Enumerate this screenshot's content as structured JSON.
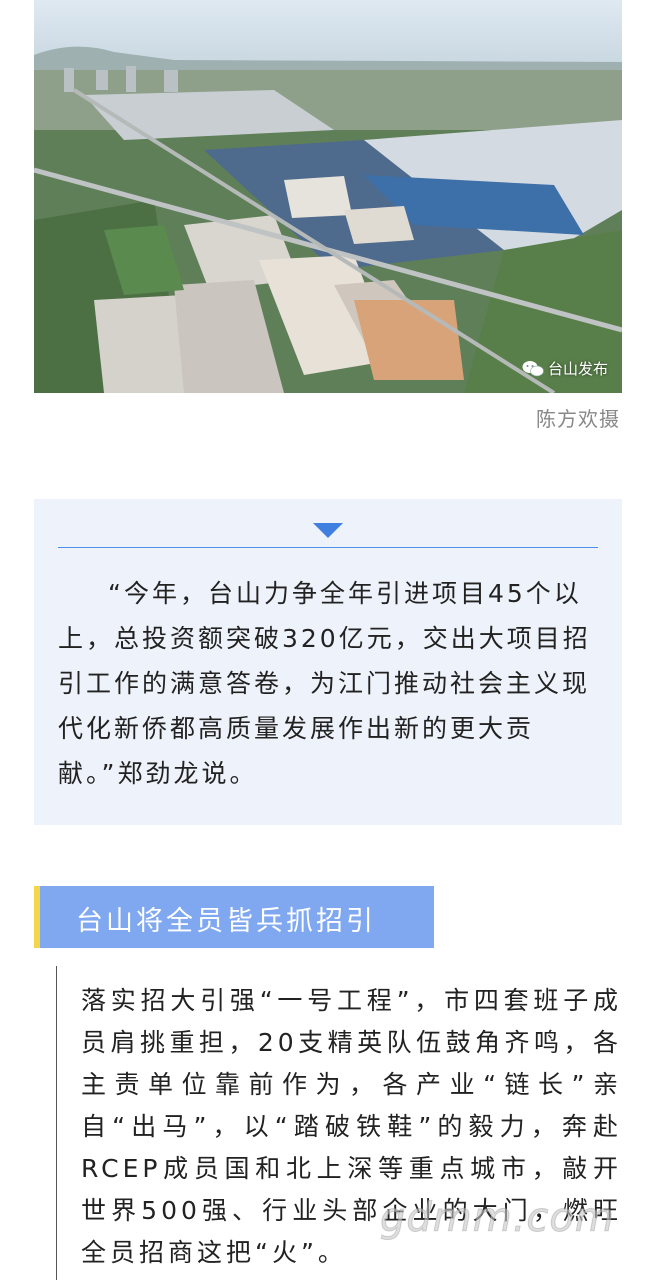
{
  "photo": {
    "watermark_label": "台山发布",
    "watermark_icon": "wechat-icon",
    "caption": "陈方欢摄"
  },
  "quote": {
    "icon": "triangle-down-icon",
    "accent_color": "#3f7fe0",
    "text": "“今年，台山力争全年引进项目45个以上，总投资额突破320亿元，交出大项目招引工作的满意答卷，为江门推动社会主义现代化新侨都高质量发展作出新的更大贡献。”郑劲龙说。"
  },
  "section": {
    "title": "台山将全员皆兵抓招引",
    "title_bg": "#7fa8f0",
    "title_accent": "#f5d64a",
    "body": "落实招大引强“一号工程”，市四套班子成员肩挑重担，20支精英队伍鼓角齐鸣，各主责单位靠前作为，各产业“链长”亲自“出马”，以“踏破铁鞋”的毅力，奔赴RCEP成员国和北上深等重点城市，敲开世界500强、行业头部企业的大门，燃旺全员招商这把“火”。"
  },
  "site_watermark": "gdmm.com"
}
